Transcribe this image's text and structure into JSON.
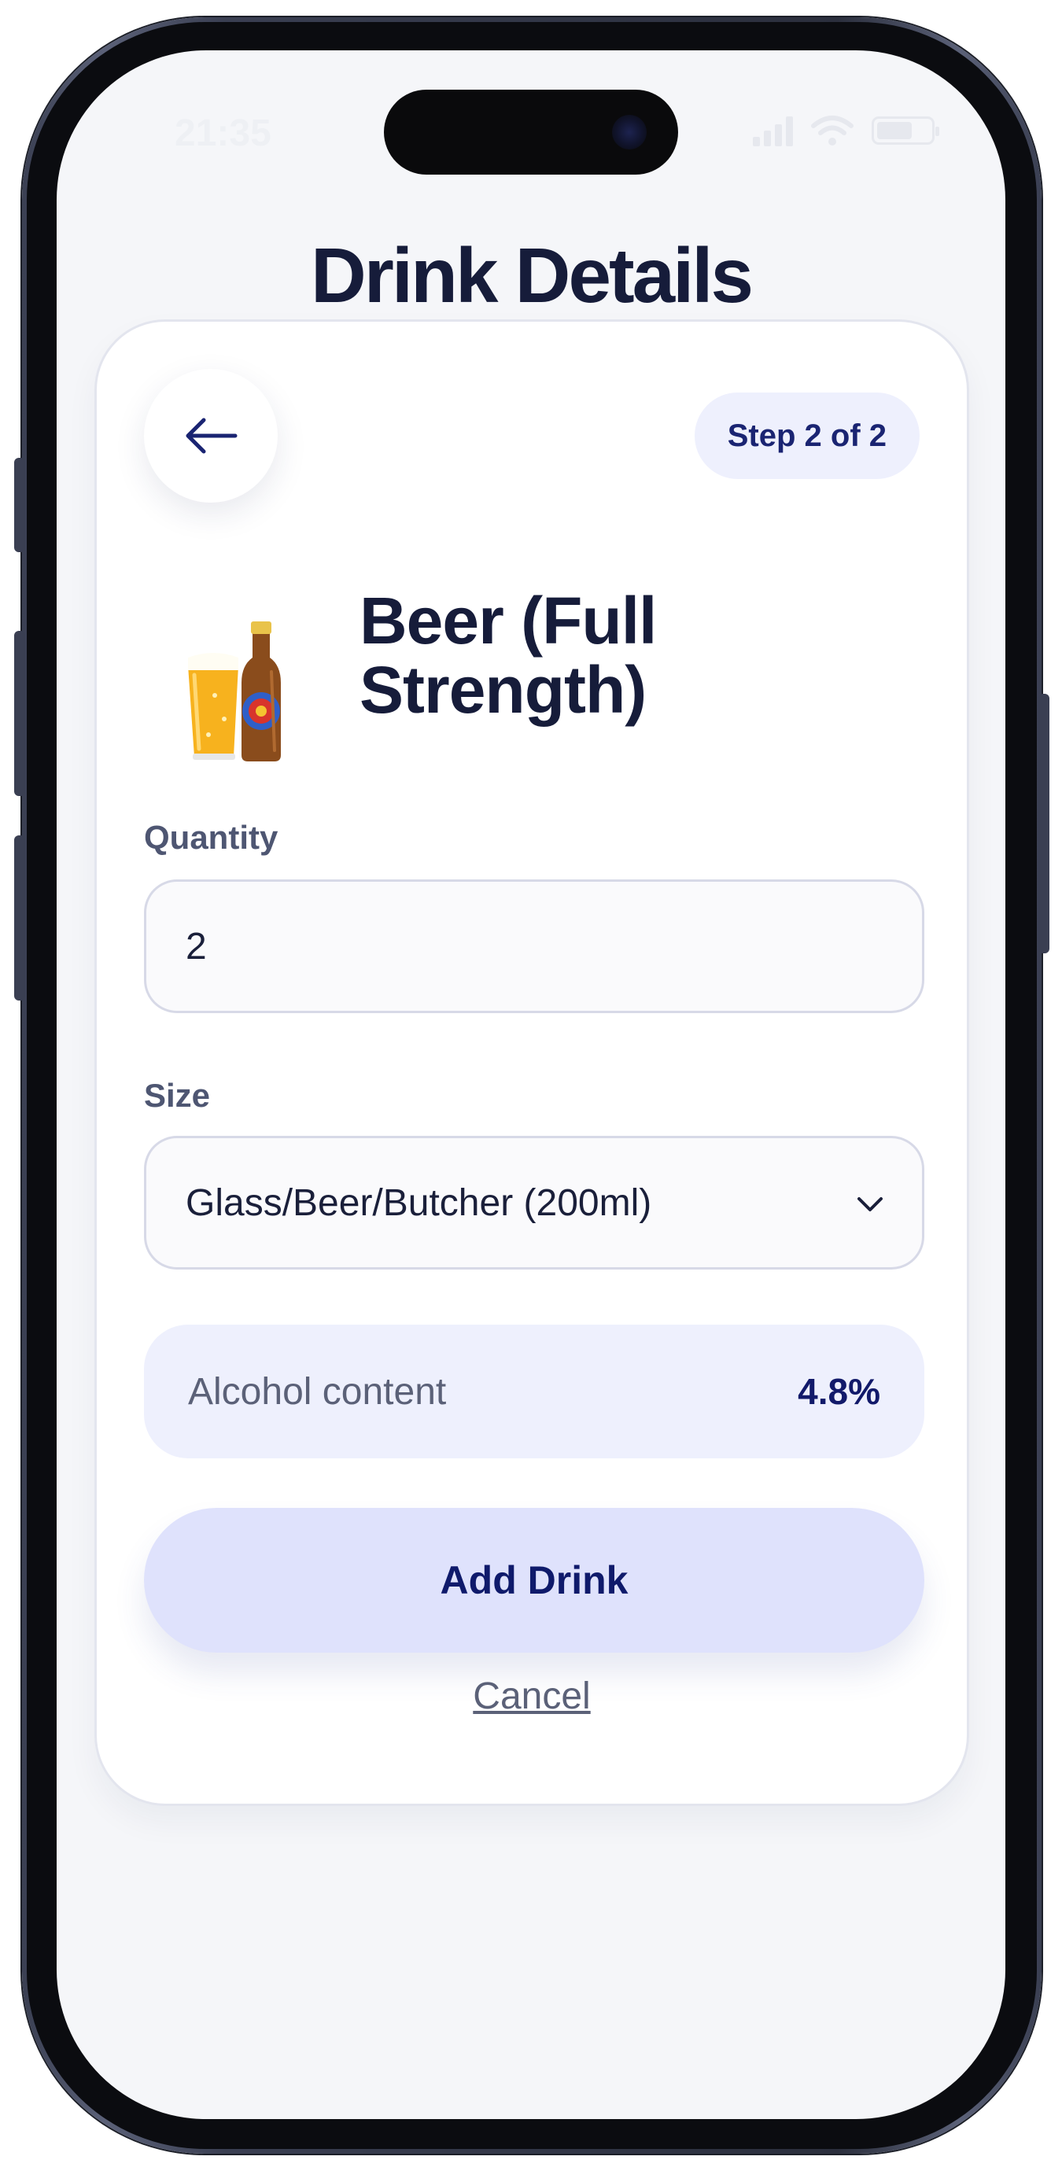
{
  "status_bar": {
    "time": "21:35"
  },
  "header": {
    "title": "Drink Details"
  },
  "card": {
    "step_label": "Step 2 of 2",
    "drink_name": "Beer (Full Strength)",
    "drink_icon": "beer-glass-and-bottle-icon",
    "quantity": {
      "label": "Quantity",
      "value": "2"
    },
    "size": {
      "label": "Size",
      "selected": "Glass/Beer/Butcher (200ml)"
    },
    "alcohol": {
      "label": "Alcohol content",
      "value": "4.8%"
    },
    "primary_action": "Add Drink",
    "secondary_action": "Cancel"
  },
  "colors": {
    "title": "#161c3a",
    "accent": "#121a6a",
    "accent_soft": "#eef0fd",
    "button_bg": "#dfe2fc",
    "background": "#f5f6f9"
  }
}
